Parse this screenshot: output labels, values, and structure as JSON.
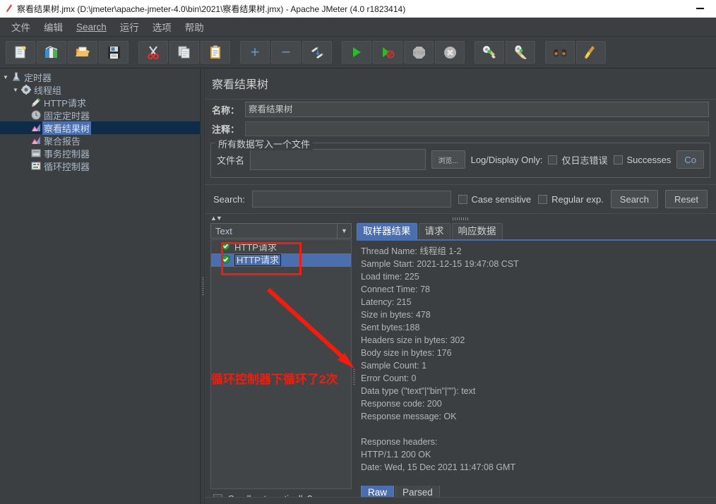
{
  "window": {
    "title": "察看结果树.jmx (D:\\jmeter\\apache-jmeter-4.0\\bin\\2021\\察看结果树.jmx) - Apache JMeter (4.0 r1823414)",
    "app_icon": "jmeter-feather-icon",
    "minimize_label": "—"
  },
  "menubar": {
    "items": [
      {
        "label": "文件",
        "name": "menu-file"
      },
      {
        "label": "编辑",
        "name": "menu-edit"
      },
      {
        "label": "Search",
        "name": "menu-search",
        "underline_first": true
      },
      {
        "label": "运行",
        "name": "menu-run"
      },
      {
        "label": "选项",
        "name": "menu-options"
      },
      {
        "label": "帮助",
        "name": "menu-help"
      }
    ]
  },
  "toolbar": {
    "buttons": [
      {
        "name": "new-button",
        "icon": "new-document-icon"
      },
      {
        "name": "templates-button",
        "icon": "templates-books-icon"
      },
      {
        "name": "open-button",
        "icon": "open-folder-icon"
      },
      {
        "name": "save-button",
        "icon": "floppy-disk-icon"
      },
      {
        "name": "cut-button",
        "icon": "scissors-icon"
      },
      {
        "name": "copy-button",
        "icon": "copy-pages-icon"
      },
      {
        "name": "paste-button",
        "icon": "clipboard-icon"
      },
      {
        "name": "expand-all-button",
        "icon": "plus-icon"
      },
      {
        "name": "collapse-all-button",
        "icon": "minus-icon"
      },
      {
        "name": "toggle-button",
        "icon": "toggle-pencils-icon"
      },
      {
        "name": "start-button",
        "icon": "green-play-icon"
      },
      {
        "name": "start-no-pauses-button",
        "icon": "play-no-pause-icon"
      },
      {
        "name": "stop-button",
        "icon": "stop-sign-icon"
      },
      {
        "name": "shutdown-button",
        "icon": "shutdown-x-icon"
      },
      {
        "name": "clear-button",
        "icon": "gear-broom-icon"
      },
      {
        "name": "clear-all-button",
        "icon": "gear-broom-all-icon"
      },
      {
        "name": "search-toolbar-button",
        "icon": "binoculars-icon"
      },
      {
        "name": "reset-search-button",
        "icon": "broom-icon"
      }
    ]
  },
  "tree": {
    "items": [
      {
        "label": "定时器",
        "icon": "test-plan-flask-icon",
        "indent": 0,
        "twisty": "▼",
        "selected": false,
        "name": "tree-item-test-plan"
      },
      {
        "label": "线程组",
        "icon": "thread-group-gear-icon",
        "indent": 1,
        "twisty": "▼",
        "selected": false,
        "name": "tree-item-thread-group"
      },
      {
        "label": "HTTP请求",
        "icon": "http-sampler-pen-icon",
        "indent": 2,
        "twisty": "",
        "selected": false,
        "name": "tree-item-http-request"
      },
      {
        "label": "固定定时器",
        "icon": "constant-timer-clock-icon",
        "indent": 2,
        "twisty": "",
        "selected": false,
        "name": "tree-item-constant-timer"
      },
      {
        "label": "察看结果树",
        "icon": "view-results-tree-icon",
        "indent": 2,
        "twisty": "",
        "selected": true,
        "name": "tree-item-view-results-tree"
      },
      {
        "label": "聚合报告",
        "icon": "aggregate-report-icon",
        "indent": 2,
        "twisty": "",
        "selected": false,
        "name": "tree-item-aggregate-report"
      },
      {
        "label": "事务控制器",
        "icon": "transaction-controller-icon",
        "indent": 2,
        "twisty": "",
        "selected": false,
        "name": "tree-item-transaction-controller"
      },
      {
        "label": "循环控制器",
        "icon": "loop-controller-icon",
        "indent": 2,
        "twisty": "",
        "selected": false,
        "name": "tree-item-loop-controller"
      }
    ]
  },
  "panel": {
    "title": "察看结果树",
    "name_label": "名称：",
    "name_value": "察看结果树",
    "comment_label": "注释：",
    "comment_value": "",
    "group_legend": "所有数据写入一个文件",
    "filename_label": "文件名",
    "filename_value": "",
    "browse_label": "浏览...",
    "logdisplay_label": "Log/Display Only:",
    "errors_only_label": "仅日志错误",
    "successes_label": "Successes",
    "configure_label": "Co",
    "errors_only_checked": false,
    "successes_checked": false
  },
  "search": {
    "label": "Search:",
    "value": "",
    "case_sensitive_label": "Case sensitive",
    "case_sensitive_checked": false,
    "regular_exp_label": "Regular exp.",
    "regular_exp_checked": false,
    "search_button": "Search",
    "reset_button": "Reset"
  },
  "results": {
    "renderer_selected": "Text",
    "scroll_label": "Scroll automatically?",
    "scroll_checked": false,
    "items": [
      {
        "label": "HTTP请求",
        "status": "success-shield-icon",
        "selected": false,
        "name": "result-item"
      },
      {
        "label": "HTTP请求",
        "status": "success-shield-icon",
        "selected": true,
        "name": "result-item"
      }
    ],
    "tabs": [
      {
        "label": "取样器结果",
        "active": true,
        "name": "tab-sampler-result"
      },
      {
        "label": "请求",
        "active": false,
        "name": "tab-request"
      },
      {
        "label": "响应数据",
        "active": false,
        "name": "tab-response-data"
      }
    ],
    "bottom_tabs": [
      {
        "label": "Raw",
        "active": true,
        "name": "tab-raw"
      },
      {
        "label": "Parsed",
        "active": false,
        "name": "tab-parsed"
      }
    ],
    "response_lines": [
      "Thread Name: 线程组 1-2",
      "Sample Start: 2021-12-15 19:47:08 CST",
      "Load time: 225",
      "Connect Time: 78",
      "Latency: 215",
      "Size in bytes: 478",
      "Sent bytes:188",
      "Headers size in bytes: 302",
      "Body size in bytes: 176",
      "Sample Count: 1",
      "Error Count: 0",
      "Data type (\"text\"|\"bin\"|\"\"): text",
      "Response code: 200",
      "Response message: OK",
      "",
      "Response headers:",
      "HTTP/1.1 200 OK",
      "Date: Wed, 15 Dec 2021 11:47:08 GMT"
    ]
  },
  "annotations": {
    "highlight_color": "#f41c0c",
    "note_text": "循环控制器下循环了2次"
  }
}
